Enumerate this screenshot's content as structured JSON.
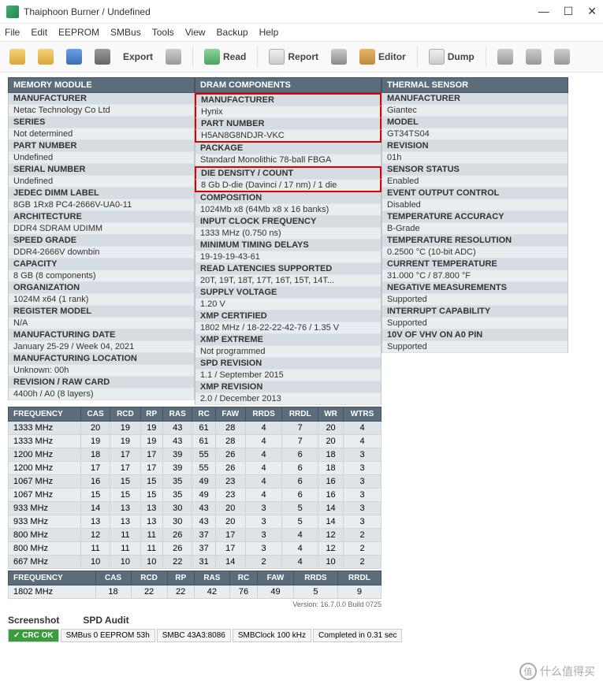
{
  "window": {
    "title": "Thaiphoon Burner / Undefined",
    "buttons": {
      "min": "—",
      "max": "☐",
      "close": "✕"
    }
  },
  "menu": [
    "File",
    "Edit",
    "EEPROM",
    "SMBus",
    "Tools",
    "View",
    "Backup",
    "Help"
  ],
  "toolbar": {
    "export": "Export",
    "read": "Read",
    "report": "Report",
    "editor": "Editor",
    "dump": "Dump"
  },
  "sections": {
    "memory_module": {
      "title": "MEMORY MODULE",
      "rows": [
        {
          "l": "MANUFACTURER",
          "v": "Netac Technology Co Ltd"
        },
        {
          "l": "SERIES",
          "v": "Not determined"
        },
        {
          "l": "PART NUMBER",
          "v": "Undefined"
        },
        {
          "l": "SERIAL NUMBER",
          "v": "Undefined"
        },
        {
          "l": "JEDEC DIMM LABEL",
          "v": "8GB 1Rx8 PC4-2666V-UA0-11"
        },
        {
          "l": "ARCHITECTURE",
          "v": "DDR4 SDRAM UDIMM"
        },
        {
          "l": "SPEED GRADE",
          "v": "DDR4-2666V downbin"
        },
        {
          "l": "CAPACITY",
          "v": "8 GB (8 components)"
        },
        {
          "l": "ORGANIZATION",
          "v": "1024M x64 (1 rank)"
        },
        {
          "l": "REGISTER MODEL",
          "v": "N/A"
        },
        {
          "l": "MANUFACTURING DATE",
          "v": "January 25-29 / Week 04, 2021"
        },
        {
          "l": "MANUFACTURING LOCATION",
          "v": "Unknown: 00h"
        },
        {
          "l": "REVISION / RAW CARD",
          "v": "4400h / A0 (8 layers)"
        }
      ]
    },
    "dram_components": {
      "title": "DRAM COMPONENTS",
      "rows": [
        {
          "l": "MANUFACTURER",
          "v": "Hynix",
          "hl": "top"
        },
        {
          "l": "PART NUMBER",
          "v": "H5AN8G8NDJR-VKC",
          "hl": "bot"
        },
        {
          "l": "PACKAGE",
          "v": "Standard Monolithic 78-ball FBGA"
        },
        {
          "l": "DIE DENSITY / COUNT",
          "v": "8 Gb D-die (Davinci / 17 nm) / 1 die",
          "hl": "solo"
        },
        {
          "l": "COMPOSITION",
          "v": "1024Mb x8 (64Mb x8 x 16 banks)"
        },
        {
          "l": "INPUT CLOCK FREQUENCY",
          "v": "1333 MHz (0.750 ns)"
        },
        {
          "l": "MINIMUM TIMING DELAYS",
          "v": "19-19-19-43-61"
        },
        {
          "l": "READ LATENCIES SUPPORTED",
          "v": "20T, 19T, 18T, 17T, 16T, 15T, 14T..."
        },
        {
          "l": "SUPPLY VOLTAGE",
          "v": "1.20 V"
        },
        {
          "l": "XMP CERTIFIED",
          "v": "1802 MHz / 18-22-22-42-76 / 1.35 V"
        },
        {
          "l": "XMP EXTREME",
          "v": "Not programmed"
        },
        {
          "l": "SPD REVISION",
          "v": "1.1 / September 2015"
        },
        {
          "l": "XMP REVISION",
          "v": "2.0 / December 2013"
        }
      ]
    },
    "thermal_sensor": {
      "title": "THERMAL SENSOR",
      "rows": [
        {
          "l": "MANUFACTURER",
          "v": "Giantec"
        },
        {
          "l": "MODEL",
          "v": "GT34TS04"
        },
        {
          "l": "REVISION",
          "v": "01h"
        },
        {
          "l": "SENSOR STATUS",
          "v": "Enabled"
        },
        {
          "l": "EVENT OUTPUT CONTROL",
          "v": "Disabled"
        },
        {
          "l": "TEMPERATURE ACCURACY",
          "v": "B-Grade"
        },
        {
          "l": "TEMPERATURE RESOLUTION",
          "v": "0.2500 °C (10-bit ADC)"
        },
        {
          "l": "CURRENT TEMPERATURE",
          "v": "31.000 °C / 87.800 °F"
        },
        {
          "l": "NEGATIVE MEASUREMENTS",
          "v": "Supported"
        },
        {
          "l": "INTERRUPT CAPABILITY",
          "v": "Supported"
        },
        {
          "l": "10V OF VHV ON A0 PIN",
          "v": "Supported"
        }
      ]
    }
  },
  "freq_headers": [
    "FREQUENCY",
    "CAS",
    "RCD",
    "RP",
    "RAS",
    "RC",
    "FAW",
    "RRDS",
    "RRDL",
    "WR",
    "WTRS"
  ],
  "freq_rows": [
    [
      "1333 MHz",
      "20",
      "19",
      "19",
      "43",
      "61",
      "28",
      "4",
      "7",
      "20",
      "4"
    ],
    [
      "1333 MHz",
      "19",
      "19",
      "19",
      "43",
      "61",
      "28",
      "4",
      "7",
      "20",
      "4"
    ],
    [
      "1200 MHz",
      "18",
      "17",
      "17",
      "39",
      "55",
      "26",
      "4",
      "6",
      "18",
      "3"
    ],
    [
      "1200 MHz",
      "17",
      "17",
      "17",
      "39",
      "55",
      "26",
      "4",
      "6",
      "18",
      "3"
    ],
    [
      "1067 MHz",
      "16",
      "15",
      "15",
      "35",
      "49",
      "23",
      "4",
      "6",
      "16",
      "3"
    ],
    [
      "1067 MHz",
      "15",
      "15",
      "15",
      "35",
      "49",
      "23",
      "4",
      "6",
      "16",
      "3"
    ],
    [
      "933 MHz",
      "14",
      "13",
      "13",
      "30",
      "43",
      "20",
      "3",
      "5",
      "14",
      "3"
    ],
    [
      "933 MHz",
      "13",
      "13",
      "13",
      "30",
      "43",
      "20",
      "3",
      "5",
      "14",
      "3"
    ],
    [
      "800 MHz",
      "12",
      "11",
      "11",
      "26",
      "37",
      "17",
      "3",
      "4",
      "12",
      "2"
    ],
    [
      "800 MHz",
      "11",
      "11",
      "11",
      "26",
      "37",
      "17",
      "3",
      "4",
      "12",
      "2"
    ],
    [
      "667 MHz",
      "10",
      "10",
      "10",
      "22",
      "31",
      "14",
      "2",
      "4",
      "10",
      "2"
    ]
  ],
  "xmp_headers": [
    "FREQUENCY",
    "CAS",
    "RCD",
    "RP",
    "RAS",
    "RC",
    "FAW",
    "RRDS",
    "RRDL"
  ],
  "xmp_rows": [
    [
      "1802 MHz",
      "18",
      "22",
      "22",
      "42",
      "76",
      "49",
      "5",
      "9"
    ]
  ],
  "version": "Version: 16.7.0.0 Build 0725",
  "bottom_links": [
    "Screenshot",
    "SPD Audit"
  ],
  "status": {
    "crc": "✓ CRC OK",
    "segs": [
      "SMBus 0 EEPROM 53h",
      "SMBC 43A3:8086",
      "SMBClock 100 kHz",
      "Completed in 0.31 sec"
    ]
  },
  "watermark": "什么值得买"
}
